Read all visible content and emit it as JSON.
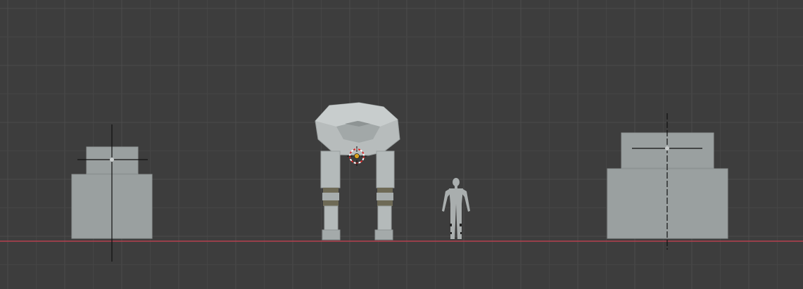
{
  "viewport": {
    "background": "#3d3d3d",
    "grid_minor_color": "#454545",
    "grid_major_color": "#4c4c4c",
    "ground_axis_color": "#b5404e",
    "object_color": "#9aa0a0",
    "object_highlight": "#b4baba",
    "crosshair_color": "#111111",
    "knee_band_color": "#6e6a56"
  },
  "scene": {
    "objects": [
      {
        "name": "left-prop-object",
        "kind": "block-prop"
      },
      {
        "name": "mech-walker-object",
        "kind": "mech-walker"
      },
      {
        "name": "human-reference-object",
        "kind": "human-figure"
      },
      {
        "name": "right-prop-object",
        "kind": "block-prop"
      }
    ],
    "cursor_3d": {
      "name": "3d-cursor",
      "colors": [
        "#d12b2b",
        "#ffffff"
      ]
    }
  }
}
